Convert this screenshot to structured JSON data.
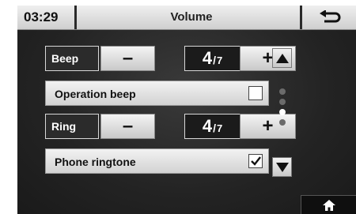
{
  "header": {
    "clock": "03:29",
    "title": "Volume",
    "back_icon": "back-arrow-icon"
  },
  "beep": {
    "label": "Beep",
    "minus": "–",
    "plus": "+",
    "value": "4",
    "max": "7"
  },
  "operation_beep": {
    "label": "Operation beep",
    "checked": false
  },
  "ring": {
    "label": "Ring",
    "minus": "–",
    "plus": "+",
    "value": "4",
    "max": "7"
  },
  "phone_ringtone": {
    "label": "Phone ringtone",
    "checked": true
  },
  "scroll": {
    "up_icon": "triangle-up-icon",
    "down_icon": "triangle-down-icon",
    "page_count": 4,
    "current_page": 3
  },
  "footer": {
    "home_icon": "home-icon"
  }
}
